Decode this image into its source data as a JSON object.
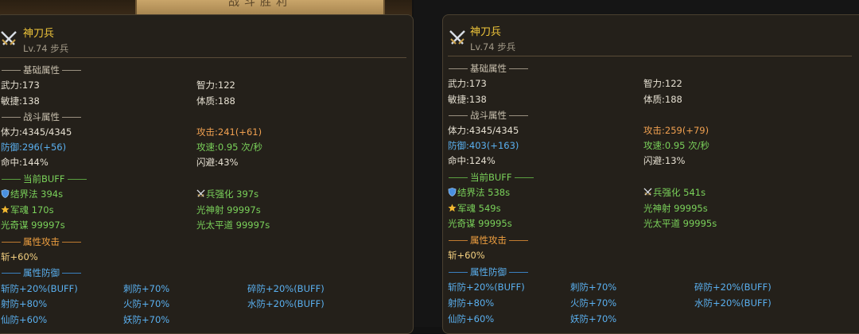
{
  "banner": {
    "title": "战斗胜利"
  },
  "left": {
    "unit_name": "神刀兵",
    "unit_level": "Lv.74 步兵",
    "sec_basic": "基础属性",
    "wuli": "武力:173",
    "zhili": "智力:122",
    "minjie": "敏捷:138",
    "tizhi": "体质:188",
    "sec_battle": "战斗属性",
    "hp": "体力:4345/4345",
    "attack": "攻击:241(+61)",
    "defense": "防御:296(+56)",
    "atk_speed": "攻速:0.95 次/秒",
    "hit": "命中:144%",
    "dodge": "闪避:43%",
    "sec_buff": "当前BUFF",
    "buff1": "结界法 394s",
    "buff2": "兵强化 397s",
    "buff3": "军魂 170s",
    "buff4": "光神射 99997s",
    "buff5": "光奇谋 99997s",
    "buff6": "光太平道 99997s",
    "sec_elem_atk": "属性攻击",
    "elem_atk": "斩+60%",
    "sec_elem_def": "属性防御",
    "def1": "斩防+20%(BUFF)",
    "def2": "刺防+70%",
    "def3": "碎防+20%(BUFF)",
    "def4": "射防+80%",
    "def5": "火防+70%",
    "def6": "水防+20%(BUFF)",
    "def7": "仙防+60%",
    "def8": "妖防+70%"
  },
  "right": {
    "unit_name": "神刀兵",
    "unit_level": "Lv.74 步兵",
    "sec_basic": "基础属性",
    "wuli": "武力:173",
    "zhili": "智力:122",
    "minjie": "敏捷:138",
    "tizhi": "体质:188",
    "sec_battle": "战斗属性",
    "hp": "体力:4345/4345",
    "attack": "攻击:259(+79)",
    "defense": "防御:403(+163)",
    "atk_speed": "攻速:0.95 次/秒",
    "hit": "命中:124%",
    "dodge": "闪避:13%",
    "sec_buff": "当前BUFF",
    "buff1": "结界法 538s",
    "buff2": "兵强化 541s",
    "buff3": "军魂 549s",
    "buff4": "光神射 99995s",
    "buff5": "光奇谋 99995s",
    "buff6": "光太平道 99995s",
    "sec_elem_atk": "属性攻击",
    "elem_atk": "斩+60%",
    "sec_elem_def": "属性防御",
    "def1": "斩防+20%(BUFF)",
    "def2": "刺防+70%",
    "def3": "碎防+20%(BUFF)",
    "def4": "射防+80%",
    "def5": "火防+70%",
    "def6": "水防+20%(BUFF)",
    "def7": "仙防+60%",
    "def8": "妖防+70%"
  },
  "icons": {
    "unit": "crossed-swords-icon",
    "barrier": "shield-icon",
    "troop_boost": "crossed-swords-icon",
    "army_soul": "star-icon"
  },
  "colors": {
    "name": "#f0c63a",
    "attack": "#f0a050",
    "defense": "#5ab0f0",
    "green": "#7ad15a",
    "panel": "#24201a"
  }
}
